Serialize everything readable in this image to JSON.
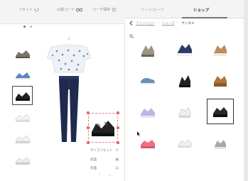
{
  "left_toolbar": {
    "reset": "リセット",
    "save": "公開コード",
    "favorites": "コーデ保存"
  },
  "carousel": {
    "count": 2,
    "active": 0
  },
  "thumbnails": [
    {
      "name": "sandal-khaki",
      "color": "#7b7560",
      "selected": false
    },
    {
      "name": "sandal-blue",
      "color": "#5d87bf",
      "selected": false
    },
    {
      "name": "sandal-black",
      "color": "#222222",
      "selected": true
    },
    {
      "name": "sandal-white-1",
      "color": "#f2f2f2",
      "selected": false
    },
    {
      "name": "sandal-white-2",
      "color": "#e8e8e8",
      "selected": false
    },
    {
      "name": "sandal-white-3",
      "color": "#dedede",
      "selected": false
    }
  ],
  "item_controls": {
    "size_reset": "サイズリセット",
    "front": "前面",
    "back": "背面"
  },
  "right_tabs": {
    "tab1": "ワードローブ",
    "tab2": "ショップ",
    "active": 1
  },
  "breadcrumb": {
    "level1": "ファッション",
    "level2": "シューズ",
    "current": "サンダル"
  },
  "shop_items": [
    {
      "name": "sandal-khaki",
      "color": "#9b9580"
    },
    {
      "name": "sandal-navy",
      "color": "#2d3a66"
    },
    {
      "name": "sandal-tan",
      "color": "#b98d5e"
    },
    {
      "name": "sneaker-denim",
      "color": "#6b8fb8"
    },
    {
      "name": "sandal-black-strap",
      "color": "#222222"
    },
    {
      "name": "sandal-brown-platform",
      "color": "#b0743c"
    },
    {
      "name": "sandal-lavender",
      "color": "#b7b9e4"
    },
    {
      "name": "sandal-white",
      "color": "#dcdcdc"
    },
    {
      "name": "sandal-black-platform",
      "color": "#2a2a2a"
    },
    {
      "name": "sandal-pink",
      "color": "#ef7080"
    },
    {
      "name": "sandal-white-flat",
      "color": "#e4e4e4"
    },
    {
      "name": "sandal-grey",
      "color": "#a7a7a7"
    }
  ]
}
